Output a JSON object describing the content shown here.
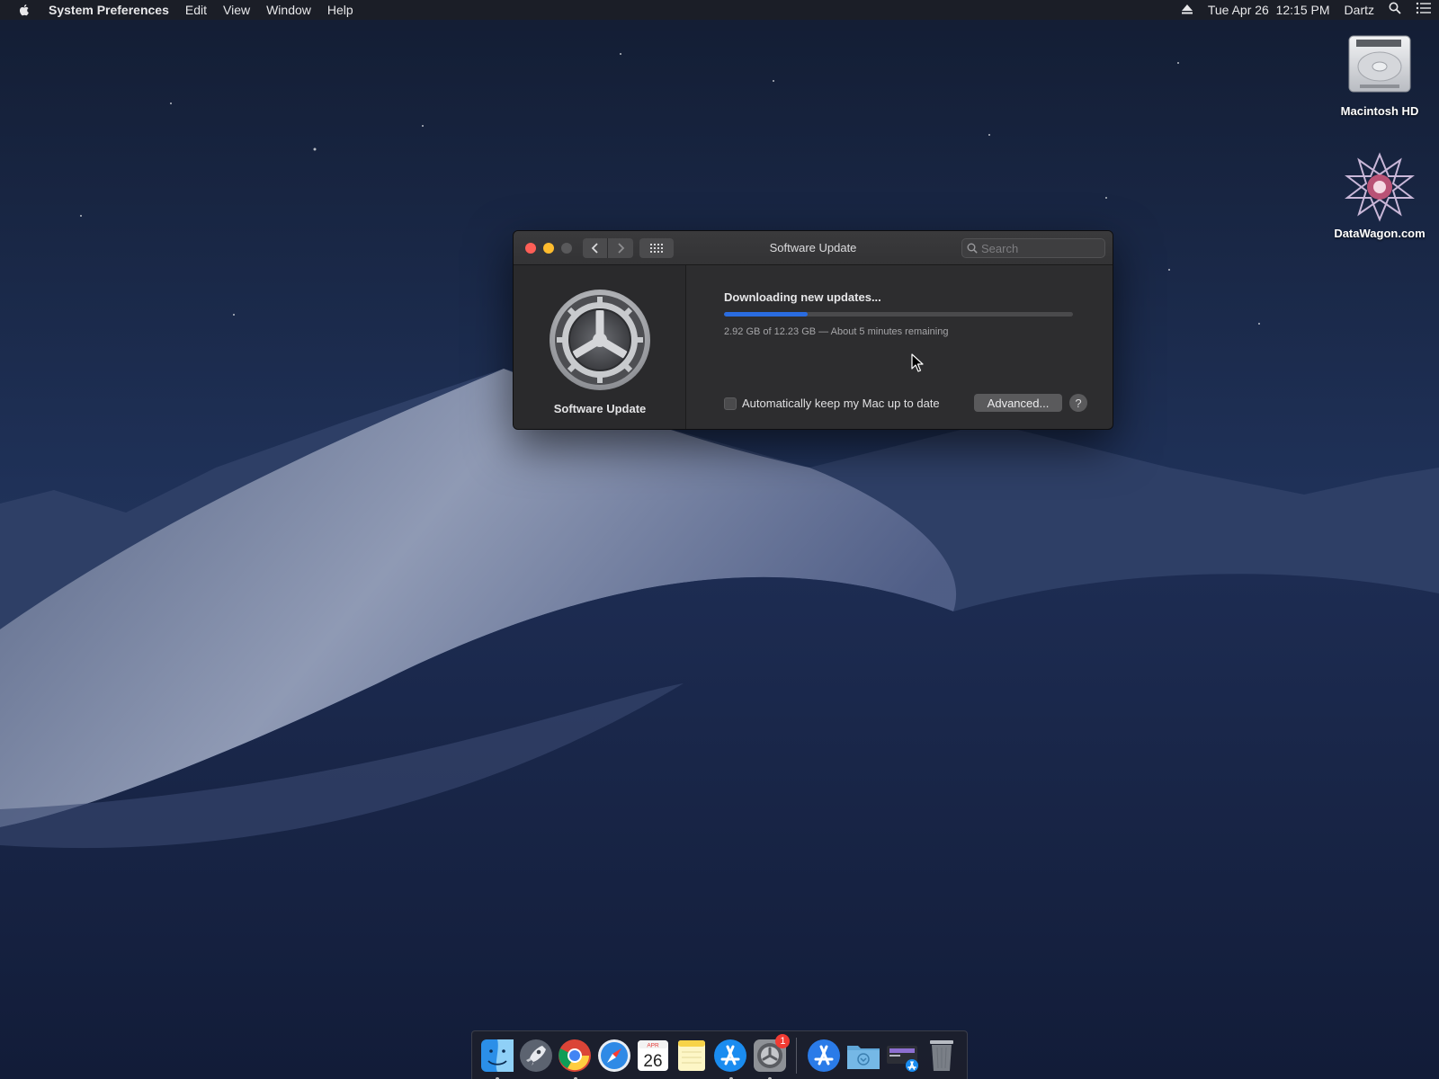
{
  "menubar": {
    "app_name": "System Preferences",
    "menus": [
      "Edit",
      "View",
      "Window",
      "Help"
    ],
    "datetime": "Tue Apr 26  12:15 PM",
    "user": "Dartz"
  },
  "desktop": {
    "icons": [
      {
        "label": "Macintosh HD",
        "icon": "hard-drive-icon"
      },
      {
        "label": "DataWagon.com",
        "icon": "datawagon-logo-icon"
      }
    ]
  },
  "window": {
    "title": "Software Update",
    "search_placeholder": "Search",
    "sidebar": {
      "icon": "software-update-gear-icon",
      "label": "Software Update"
    },
    "status": {
      "title": "Downloading new updates...",
      "progress": 0.239,
      "detail": "2.92 GB of 12.23 GB — About 5 minutes remaining"
    },
    "auto_update": {
      "label": "Automatically keep my Mac up to date",
      "checked": false
    },
    "advanced_label": "Advanced...",
    "help_label": "?"
  },
  "dock": {
    "items": [
      {
        "name": "finder-icon",
        "running": true
      },
      {
        "name": "launchpad-icon",
        "running": false
      },
      {
        "name": "chrome-icon",
        "running": true
      },
      {
        "name": "safari-icon",
        "running": false
      },
      {
        "name": "calendar-icon",
        "running": false,
        "month": "APR",
        "day": "26"
      },
      {
        "name": "notes-icon",
        "running": false
      },
      {
        "name": "app-store-icon",
        "running": true
      },
      {
        "name": "system-preferences-icon",
        "running": true,
        "badge": "1"
      },
      {
        "name": "software-update-app-icon",
        "running": false
      },
      {
        "name": "downloads-folder-icon",
        "running": false
      },
      {
        "name": "installer-icon",
        "running": false
      },
      {
        "name": "trash-icon",
        "running": false
      }
    ]
  },
  "colors": {
    "accent": "#2a6ce0",
    "close": "#fe5f57",
    "minimize": "#febc2e",
    "badge": "#f23b33"
  }
}
